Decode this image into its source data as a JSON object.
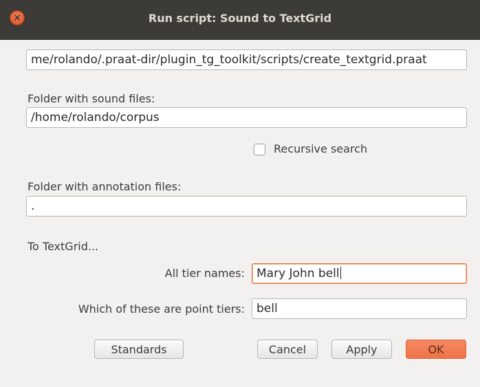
{
  "window": {
    "title": "Run script: Sound to TextGrid",
    "close_glyph": "×"
  },
  "script_path": "me/rolando/.praat-dir/plugin_tg_toolkit/scripts/create_textgrid.praat",
  "sound_folder": {
    "label": "Folder with sound files:",
    "value": "/home/rolando/corpus"
  },
  "recursive": {
    "label": "Recursive search",
    "checked": false
  },
  "annotation_folder": {
    "label": "Folder with annotation files:",
    "value": "."
  },
  "section": {
    "heading": "To TextGrid..."
  },
  "tier_names": {
    "label": "All tier names:",
    "value": "Mary John bell"
  },
  "point_tiers": {
    "label": "Which of these are point tiers:",
    "value": "bell"
  },
  "buttons": {
    "standards": "Standards",
    "cancel": "Cancel",
    "apply": "Apply",
    "ok": "OK"
  },
  "colors": {
    "titlebar": "#3c3b37",
    "accent": "#ee7348",
    "background": "#f2f1f0"
  }
}
